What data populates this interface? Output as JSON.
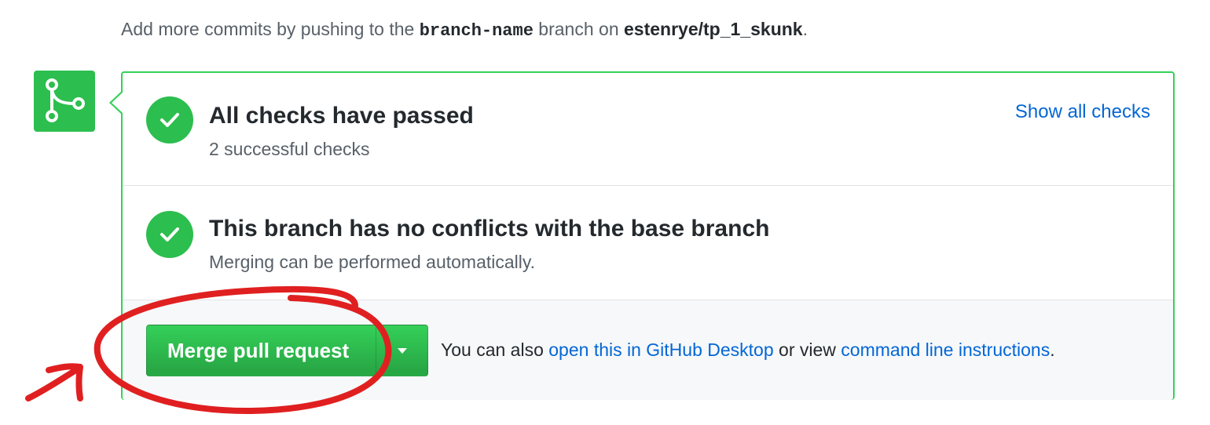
{
  "hint": {
    "prefix": "Add more commits by pushing to the ",
    "branch": "branch-name",
    "middle": " branch on ",
    "repo": "estenrye/tp_1_skunk",
    "suffix": "."
  },
  "checks": {
    "title": "All checks have passed",
    "subtitle": "2 successful checks",
    "show_all_link": "Show all checks",
    "status_icon": "check-icon"
  },
  "conflicts": {
    "title": "This branch has no conflicts with the base branch",
    "subtitle": "Merging can be performed automatically.",
    "status_icon": "check-icon"
  },
  "merge": {
    "button_label": "Merge pull request",
    "dropdown_icon": "triangle-down-icon",
    "alt_prefix": "You can also ",
    "desktop_link": "open this in GitHub Desktop",
    "alt_middle": " or view ",
    "cli_link": "command line instructions",
    "alt_suffix": "."
  },
  "badge_icon": "git-merge-icon",
  "colors": {
    "success": "#2cbe4e",
    "border": "#34d058",
    "link": "#0366d6",
    "annotation": "#e02020"
  }
}
